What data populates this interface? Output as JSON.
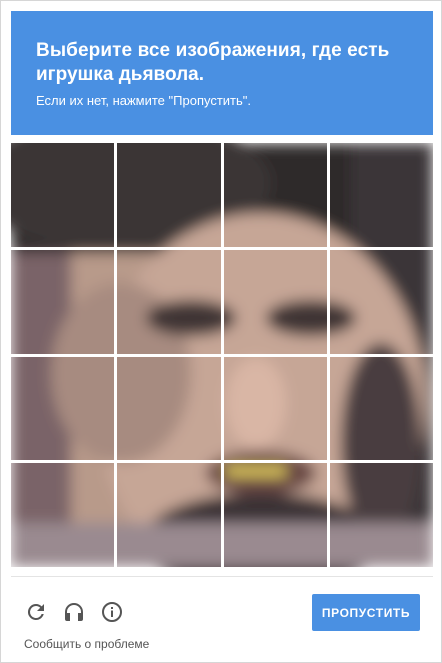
{
  "challenge": {
    "instruction_line1": "Выберите все изображения, где есть",
    "instruction_target": "игрушка дьявола.",
    "instruction_hint": "Если их нет, нажмите \"Пропустить\"."
  },
  "grid": {
    "rows": 4,
    "columns": 4
  },
  "footer": {
    "reload_icon": "reload-icon",
    "audio_icon": "headphones-icon",
    "info_icon": "info-icon",
    "skip_label": "ПРОПУСТИТЬ",
    "report_label": "Сообщить о проблеме"
  },
  "colors": {
    "accent": "#4a90e2",
    "icon": "#555555"
  }
}
